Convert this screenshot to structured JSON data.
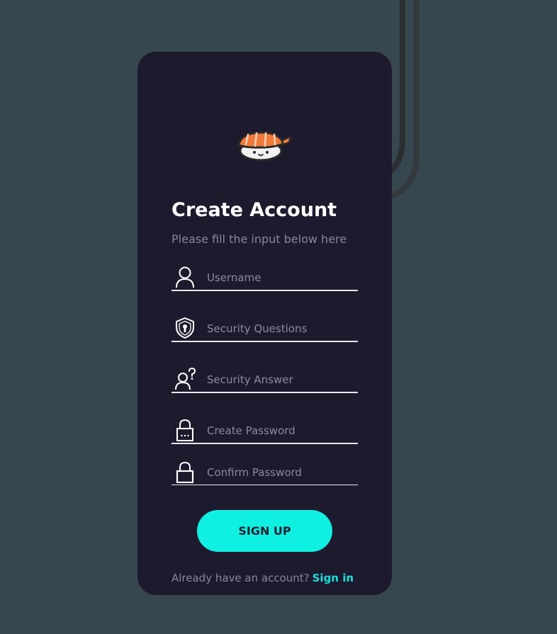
{
  "colors": {
    "background": "#37474f",
    "card": "#1e1a2e",
    "accent": "#0ff0e2",
    "link": "#14e0df",
    "muted_text": "#8a8499",
    "field_line": "#e8e6ef"
  },
  "header": {
    "mascot_icon": "sushi-mascot-icon",
    "title": "Create Account",
    "subtitle": "Please fill the input below here"
  },
  "form": {
    "fields": [
      {
        "icon": "user-icon",
        "placeholder": "Username",
        "value": ""
      },
      {
        "icon": "shield-keyhole-icon",
        "placeholder": "Security Questions",
        "value": ""
      },
      {
        "icon": "user-question-icon",
        "placeholder": "Security Answer",
        "value": ""
      },
      {
        "icon": "lock-dots-icon",
        "placeholder": "Create Password",
        "value": ""
      },
      {
        "icon": "lock-icon",
        "placeholder": "Confirm Password",
        "value": ""
      }
    ],
    "submit_label": "SIGN UP"
  },
  "footer": {
    "prompt": "Already have an account?",
    "link_label": "Sign in"
  }
}
